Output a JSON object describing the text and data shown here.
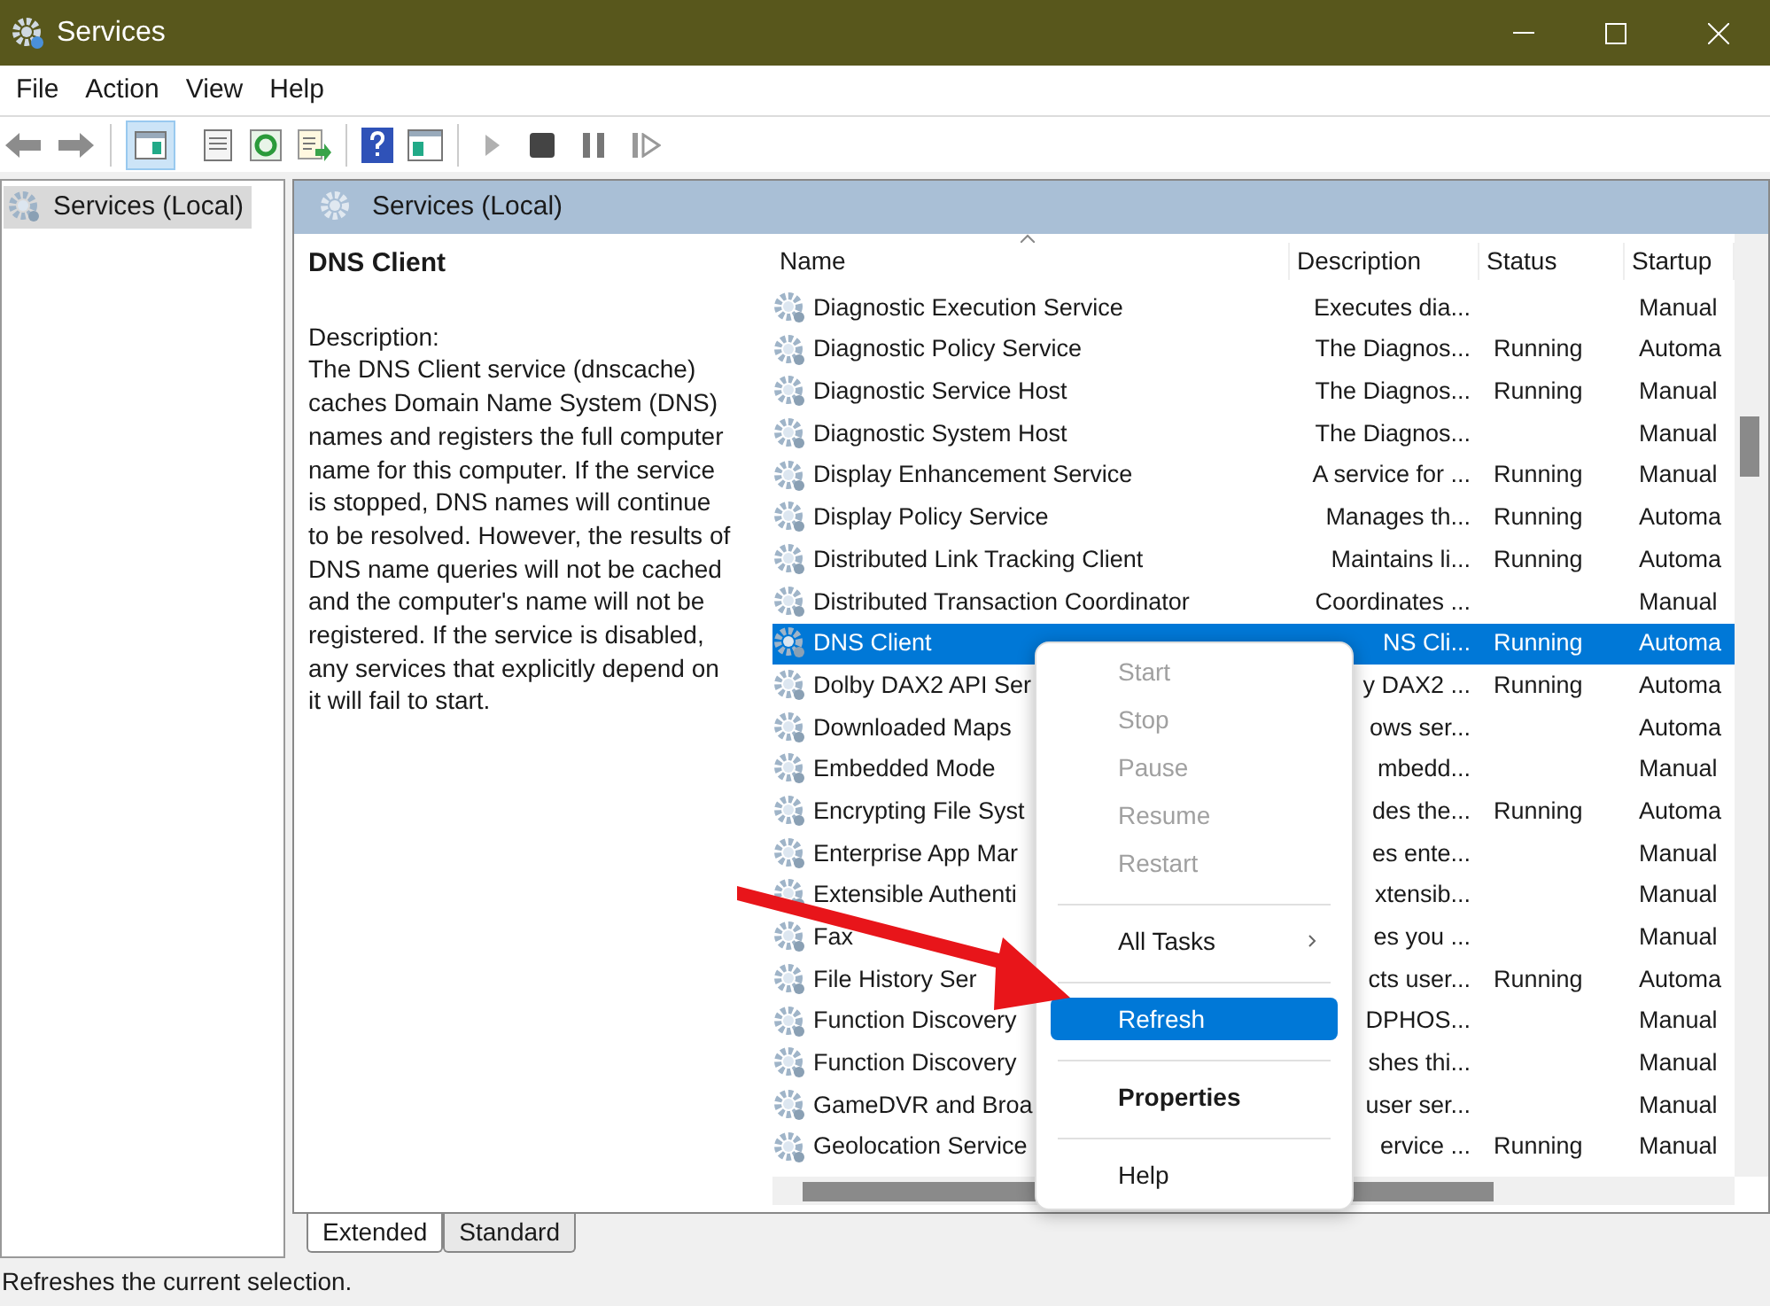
{
  "window": {
    "title": "Services"
  },
  "menu_bar": [
    {
      "label": "File"
    },
    {
      "label": "Action"
    },
    {
      "label": "View"
    },
    {
      "label": "Help"
    }
  ],
  "tree": [
    {
      "label": "Services (Local)",
      "selected": true
    }
  ],
  "panel": {
    "title": "Services (Local)"
  },
  "details": {
    "title": "DNS Client",
    "label": "Description:",
    "text": "The DNS Client service (dnscache) caches Domain Name System (DNS) names and registers the full computer name for this computer. If the service is stopped, DNS names will continue to be resolved. However, the results of DNS name queries will not be cached and the computer's name will not be registered. If the service is disabled, any services that explicitly depend on it will fail to start."
  },
  "table": {
    "columns": [
      "Name",
      "Description",
      "Status",
      "Startup"
    ],
    "rows": [
      {
        "name": "Diagnostic Execution Service",
        "description": "Executes dia...",
        "status": "",
        "startup": "Manual",
        "selected": false
      },
      {
        "name": "Diagnostic Policy Service",
        "description": "The Diagnos...",
        "status": "Running",
        "startup": "Automa",
        "selected": false
      },
      {
        "name": "Diagnostic Service Host",
        "description": "The Diagnos...",
        "status": "Running",
        "startup": "Manual",
        "selected": false
      },
      {
        "name": "Diagnostic System Host",
        "description": "The Diagnos...",
        "status": "",
        "startup": "Manual",
        "selected": false
      },
      {
        "name": "Display Enhancement Service",
        "description": "A service for ...",
        "status": "Running",
        "startup": "Manual",
        "selected": false
      },
      {
        "name": "Display Policy Service",
        "description": "Manages th...",
        "status": "Running",
        "startup": "Automa",
        "selected": false
      },
      {
        "name": "Distributed Link Tracking Client",
        "description": "Maintains li...",
        "status": "Running",
        "startup": "Automa",
        "selected": false
      },
      {
        "name": "Distributed Transaction Coordinator",
        "description": "Coordinates ...",
        "status": "",
        "startup": "Manual",
        "selected": false
      },
      {
        "name": "DNS Client",
        "description": "NS Cli...",
        "status": "Running",
        "startup": "Automa",
        "selected": true
      },
      {
        "name": "Dolby DAX2 API Ser",
        "description": "y DAX2 ...",
        "status": "Running",
        "startup": "Automa",
        "selected": false
      },
      {
        "name": "Downloaded Maps",
        "description": "ows ser...",
        "status": "",
        "startup": "Automa",
        "selected": false
      },
      {
        "name": "Embedded Mode",
        "description": "mbedd...",
        "status": "",
        "startup": "Manual",
        "selected": false
      },
      {
        "name": "Encrypting File Syst",
        "description": "des the...",
        "status": "Running",
        "startup": "Automa",
        "selected": false
      },
      {
        "name": "Enterprise App Mar",
        "description": "es ente...",
        "status": "",
        "startup": "Manual",
        "selected": false
      },
      {
        "name": "Extensible Authenti",
        "description": "xtensib...",
        "status": "",
        "startup": "Manual",
        "selected": false
      },
      {
        "name": "Fax",
        "description": "es you ...",
        "status": "",
        "startup": "Manual",
        "selected": false
      },
      {
        "name": "File History Ser",
        "description": "cts user...",
        "status": "Running",
        "startup": "Automa",
        "selected": false
      },
      {
        "name": "Function Discovery",
        "description": "DPHOS...",
        "status": "",
        "startup": "Manual",
        "selected": false
      },
      {
        "name": "Function Discovery",
        "description": "shes thi...",
        "status": "",
        "startup": "Manual",
        "selected": false
      },
      {
        "name": "GameDVR and Broa",
        "description": "user ser...",
        "status": "",
        "startup": "Manual",
        "selected": false
      },
      {
        "name": "Geolocation Service",
        "description": "ervice ...",
        "status": "Running",
        "startup": "Manual",
        "selected": false
      }
    ]
  },
  "context_menu": {
    "items": [
      {
        "kind": "item",
        "label": "Start",
        "disabled": true,
        "selected": false
      },
      {
        "kind": "item",
        "label": "Stop",
        "disabled": true,
        "selected": false
      },
      {
        "kind": "item",
        "label": "Pause",
        "disabled": true,
        "selected": false
      },
      {
        "kind": "item",
        "label": "Resume",
        "disabled": true,
        "selected": false
      },
      {
        "kind": "item",
        "label": "Restart",
        "disabled": true,
        "selected": false
      },
      {
        "kind": "separator"
      },
      {
        "kind": "submenu",
        "label": "All Tasks",
        "disabled": false,
        "selected": false
      },
      {
        "kind": "separator"
      },
      {
        "kind": "item",
        "label": "Refresh",
        "disabled": false,
        "selected": true
      },
      {
        "kind": "separator"
      },
      {
        "kind": "default",
        "label": "Properties",
        "disabled": false,
        "selected": false
      },
      {
        "kind": "separator"
      },
      {
        "kind": "item",
        "label": "Help",
        "disabled": false,
        "selected": false
      }
    ]
  },
  "view_tabs": [
    {
      "label": "Extended",
      "selected": true
    },
    {
      "label": "Standard",
      "selected": false
    }
  ],
  "status_bar": {
    "text": "Refreshes the current selection."
  }
}
